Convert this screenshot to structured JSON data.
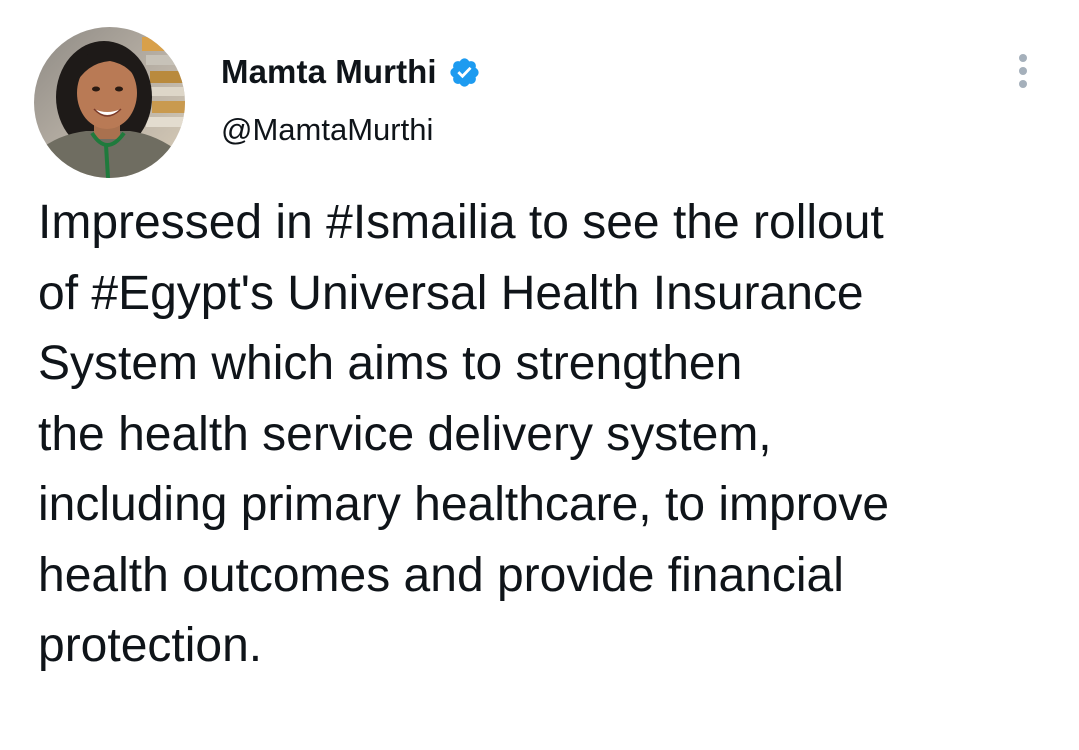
{
  "author": {
    "name": "Mamta Murthi",
    "handle": "@MamtaMurthi",
    "verified_icon": "verified-badge-icon",
    "avatar_icon": "profile-avatar"
  },
  "menu": {
    "icon": "more-options-icon"
  },
  "tweet": {
    "lines": [
      "Impressed in #Ismailia to see the rollout",
      "of #Egypt's Universal Health Insurance",
      "System which aims to strengthen",
      "the health service delivery system,",
      "including primary healthcare, to improve",
      "health outcomes and provide financial",
      "protection."
    ]
  },
  "colors": {
    "text": "#0f1419",
    "verified": "#1d9bf0",
    "menu_dots": "#a5b0bb",
    "background": "#ffffff"
  }
}
